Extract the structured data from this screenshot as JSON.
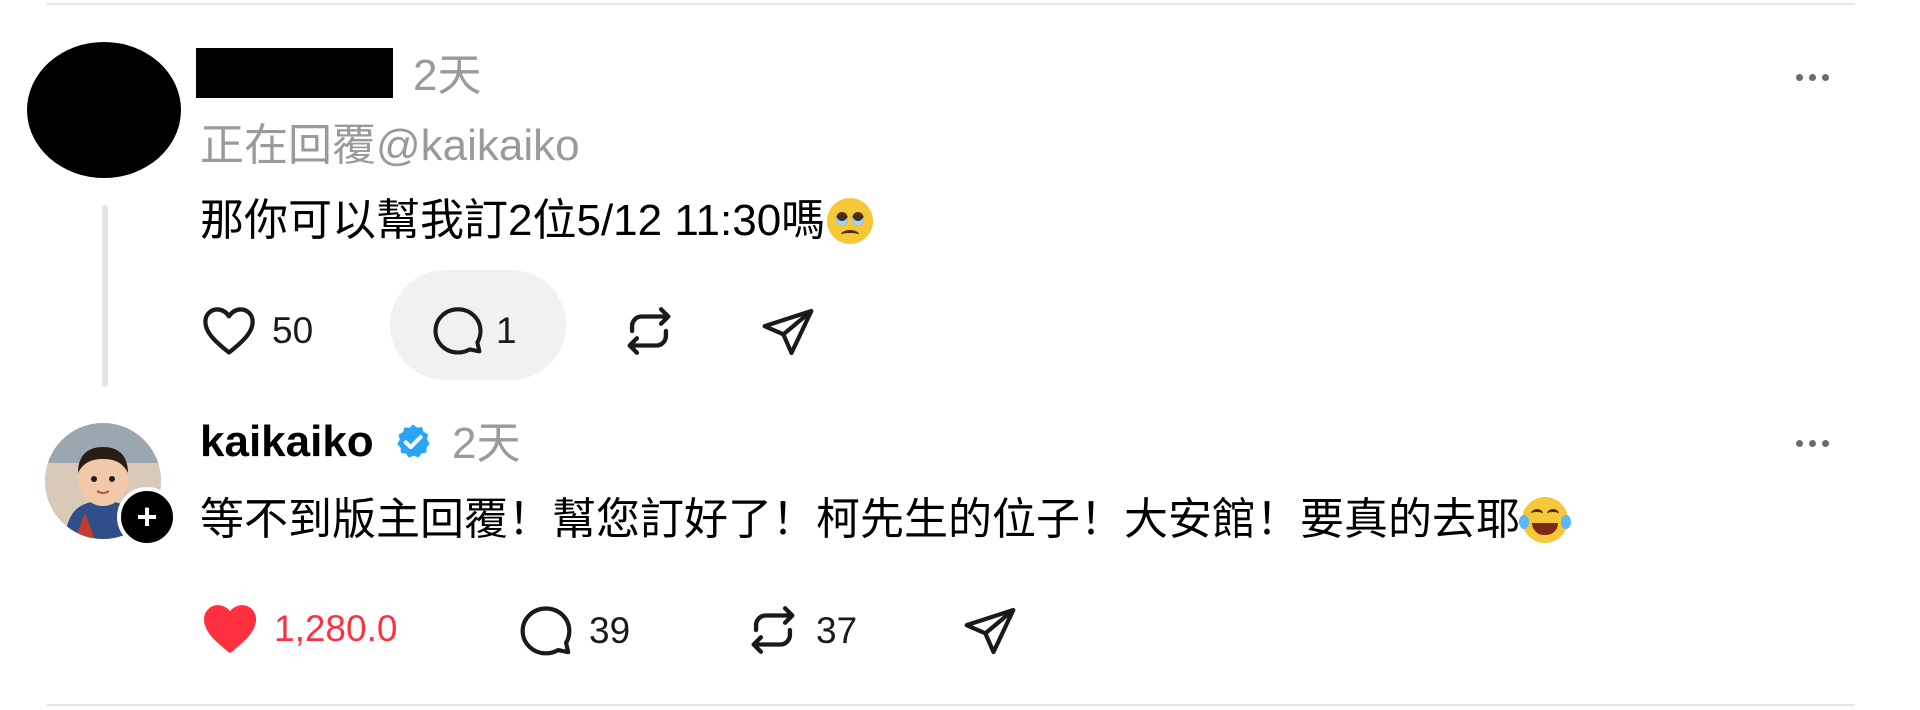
{
  "comment1": {
    "timestamp": "2天",
    "reply_to": "正在回覆@kaikaiko",
    "text": "那你可以幫我訂2位5/12 11:30嗎",
    "emoji": "pleading-face",
    "likes": "50",
    "replies": "1"
  },
  "comment2": {
    "username": "kaikaiko",
    "verified": true,
    "timestamp": "2天",
    "text": "等不到版主回覆！幫您訂好了！柯先生的位子！大安館！要真的去耶",
    "emoji": "face-with-tears-of-joy",
    "likes": "1,280.0",
    "liked": true,
    "replies": "39",
    "reposts": "37"
  },
  "icons": {
    "like": "heart-icon",
    "reply": "comment-bubble-icon",
    "repost": "repost-icon",
    "share": "send-icon",
    "more": "more-options-icon"
  },
  "colors": {
    "liked": "#ff3040",
    "verified": "#2aa4f4",
    "muted": "#9a9a9a"
  }
}
